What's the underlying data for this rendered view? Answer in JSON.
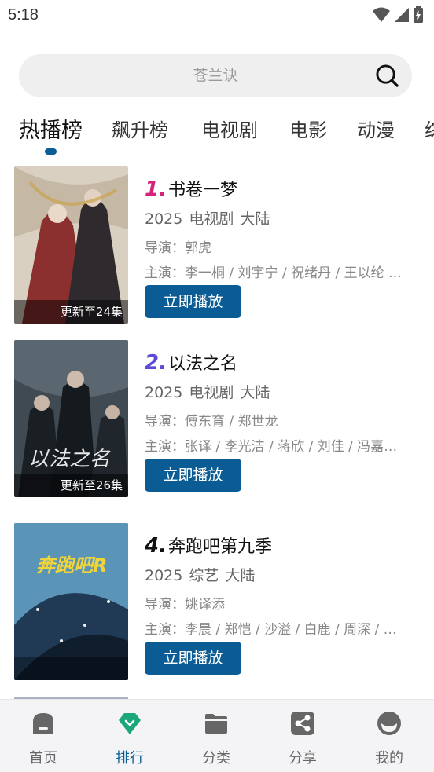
{
  "status_bar": {
    "time": "5:18"
  },
  "search": {
    "placeholder": "苍兰诀"
  },
  "tabs": [
    {
      "label": "热播榜",
      "active": true
    },
    {
      "label": "飙升榜"
    },
    {
      "label": "电视剧"
    },
    {
      "label": "电影"
    },
    {
      "label": "动漫"
    },
    {
      "label": "综"
    }
  ],
  "list": [
    {
      "rank": "1.",
      "rank_color": "#d6227a",
      "title": "书卷一梦",
      "year": "2025",
      "genre": "电视剧",
      "region": "大陆",
      "director": "导演：郭虎",
      "cast": "主演：李一桐 / 刘宇宁 / 祝绪丹 / 王以纶 …",
      "badge": "更新至24集",
      "play_label": "立即播放",
      "poster_colors": [
        "#d9d0c2",
        "#8c2f2f",
        "#2f2a2e"
      ]
    },
    {
      "rank": "2.",
      "rank_color": "#5b4bd8",
      "title": "以法之名",
      "year": "2025",
      "genre": "电视剧",
      "region": "大陆",
      "director": "导演：傅东育 / 郑世龙",
      "cast": "主演：张译 / 李光洁 / 蒋欣 / 刘佳 / 冯嘉…",
      "badge": "更新至26集",
      "play_label": "立即播放",
      "poster_colors": [
        "#3f4a52",
        "#1a1f24",
        "#9aa7ad"
      ]
    },
    {
      "rank": "4.",
      "rank_color": "#111111",
      "title": "奔跑吧第九季",
      "year": "2025",
      "genre": "综艺",
      "region": "大陆",
      "director": "导演：姚译添",
      "cast": "主演：李晨 / 郑恺 / 沙溢 / 白鹿 / 周深 / …",
      "badge": "",
      "play_label": "立即播放",
      "poster_colors": [
        "#5a95b8",
        "#203a55",
        "#f1d43a"
      ]
    }
  ],
  "bottom_nav": [
    {
      "label": "首页",
      "icon": "home-icon"
    },
    {
      "label": "排行",
      "icon": "rank-icon",
      "active": true
    },
    {
      "label": "分类",
      "icon": "folder-icon"
    },
    {
      "label": "分享",
      "icon": "share-icon"
    },
    {
      "label": "我的",
      "icon": "profile-icon"
    }
  ],
  "colors": {
    "accent": "#0b5c94",
    "nav_active": "#1aa77b"
  }
}
